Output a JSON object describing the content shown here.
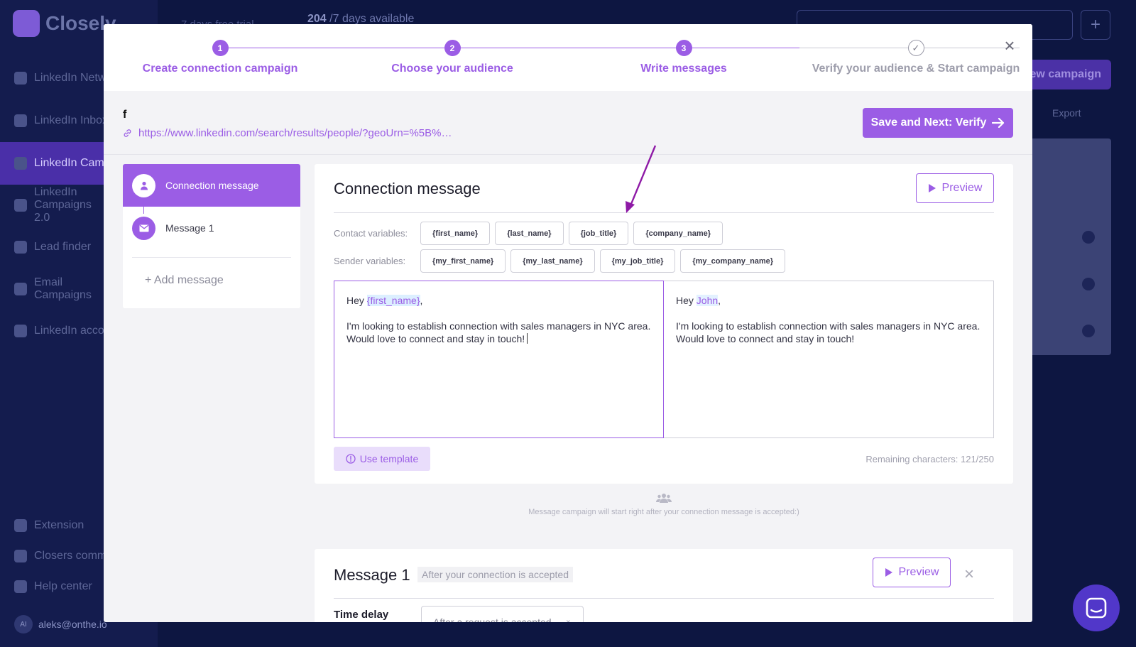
{
  "background": {
    "brand": "Closely",
    "trial_text": "7 days free trial",
    "days_count": "204",
    "days_suffix": "/7 days available",
    "nav": [
      {
        "label": "LinkedIn Network"
      },
      {
        "label": "LinkedIn Inbox"
      },
      {
        "label": "LinkedIn Campaigns"
      },
      {
        "label": "LinkedIn Campaigns 2.0"
      },
      {
        "label": "Lead finder"
      },
      {
        "label": "Email Campaigns"
      },
      {
        "label": "LinkedIn accounts"
      }
    ],
    "bottom_nav": [
      {
        "label": "Extension"
      },
      {
        "label": "Closers community"
      },
      {
        "label": "Help center"
      }
    ],
    "user_initials": "AI",
    "user_email": "aleks@onthe.io",
    "new_campaign_label": "New campaign",
    "export_label": "Export",
    "plus_label": "+"
  },
  "stepper": {
    "steps": [
      {
        "number": "1",
        "label": "Create connection campaign"
      },
      {
        "number": "2",
        "label": "Choose your audience"
      },
      {
        "number": "3",
        "label": "Write messages"
      },
      {
        "number": "✓",
        "label": "Verify your audience & Start campaign"
      }
    ],
    "close_glyph": "×"
  },
  "campaign": {
    "name": "f",
    "url": "https://www.linkedin.com/search/results/people/?geoUrn=%5B%…",
    "save_next_label": "Save and Next: Verify"
  },
  "left_nav": {
    "items": [
      {
        "label": "Connection message"
      },
      {
        "label": "Message 1"
      }
    ],
    "add_label": "+ Add message"
  },
  "connection_card": {
    "title": "Connection message",
    "preview_label": "Preview",
    "contact_label": "Contact variables:",
    "contact_vars": [
      "{first_name}",
      "{last_name}",
      "{job_title}",
      "{company_name}"
    ],
    "sender_label": "Sender variables:",
    "sender_vars": [
      "{my_first_name}",
      "{my_last_name}",
      "{my_job_title}",
      "{my_company_name}"
    ],
    "editor": {
      "greeting": "Hey ",
      "variable": "{first_name}",
      "comma": ",",
      "line1": "I'm looking to establish connection with sales managers in NYC area.",
      "line2": "Would love to connect and stay in touch!"
    },
    "preview": {
      "greeting": "Hey ",
      "name": "John",
      "comma": ",",
      "line1": "I'm looking to establish connection with sales managers in NYC area.",
      "line2": "Would love to connect and stay in touch!"
    },
    "use_template_label": "Use template",
    "remaining_label": "Remaining characters: 121/250"
  },
  "between_note": "Message campaign will start right after your connection message is accepted:)",
  "message1_card": {
    "title": "Message 1",
    "subtitle": "After your connection is accepted",
    "preview_label": "Preview",
    "close_glyph": "×",
    "delay_label": "Time delay",
    "delay_value": "After a request is accepted"
  },
  "colors": {
    "accent": "#9b5de5",
    "backdrop": "#0d1641",
    "annotation_arrow": "#8e1aa6"
  }
}
